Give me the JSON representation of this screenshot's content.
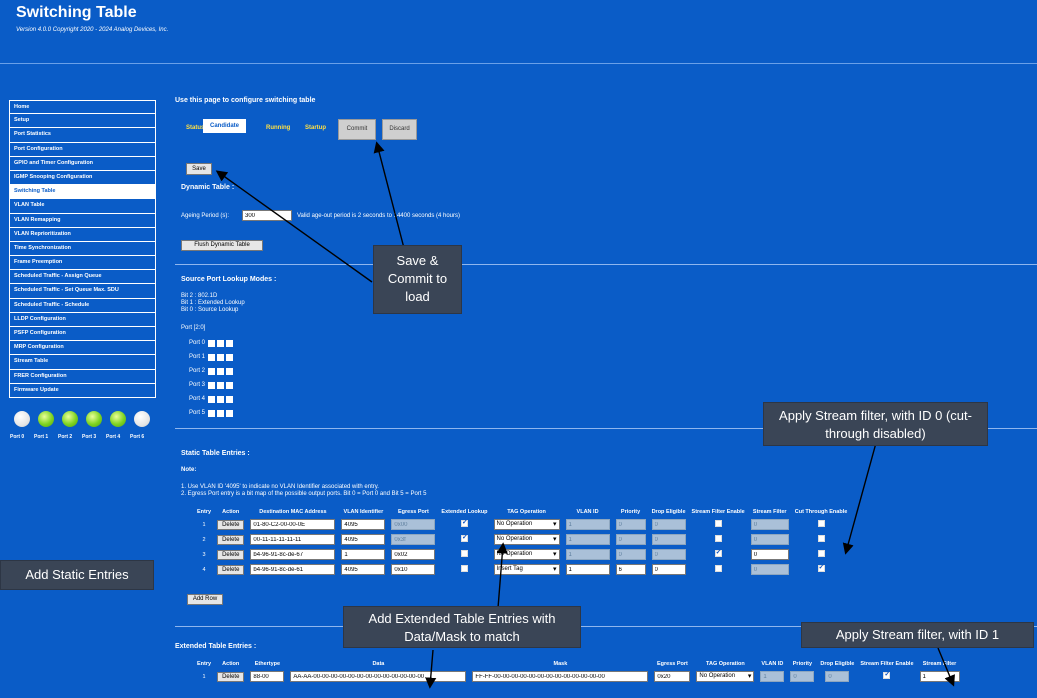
{
  "header": {
    "title": "Switching Table",
    "version": "Version 4.0.0 Copyright 2020 - 2024 Analog Devices, Inc."
  },
  "sidebar": {
    "items": [
      {
        "label": "Home"
      },
      {
        "label": "Setup"
      },
      {
        "label": "Port Statistics"
      },
      {
        "label": "Port Configuration"
      },
      {
        "label": "GPIO and Timer Configuration"
      },
      {
        "label": "IGMP Snooping Configuration"
      },
      {
        "label": "Switching Table"
      },
      {
        "label": "VLAN Table"
      },
      {
        "label": "VLAN Remapping"
      },
      {
        "label": "VLAN Reprioritization"
      },
      {
        "label": "Time Synchronization"
      },
      {
        "label": "Frame Preemption"
      },
      {
        "label": "Scheduled Traffic - Assign Queue"
      },
      {
        "label": "Scheduled Traffic - Set Queue Max. SDU"
      },
      {
        "label": "Scheduled Traffic - Schedule"
      },
      {
        "label": "LLDP Configuration"
      },
      {
        "label": "PSFP Configuration"
      },
      {
        "label": "MRP Configuration"
      },
      {
        "label": "Stream Table"
      },
      {
        "label": "FRER Configuration"
      },
      {
        "label": "Firmware Update"
      }
    ],
    "ports": [
      "Port 0",
      "Port 1",
      "Port 2",
      "Port 3",
      "Port 4",
      "Port 6"
    ]
  },
  "main": {
    "intro": "Use this page to configure switching table",
    "tabs": {
      "status": "Status",
      "candidate": "Candidate",
      "running": "Running",
      "startup": "Startup"
    },
    "commit": "Commit",
    "discard": "Discard",
    "save": "Save",
    "dynamic_title": "Dynamic Table :",
    "ageing_label": "Ageing Period (s):",
    "ageing_value": "300",
    "ageing_hint": "Valid age-out period is 2 seconds to 14400 seconds (4 hours)",
    "flush": "Flush Dynamic Table",
    "source_title": "Source Port Lookup Modes :",
    "bit2": "Bit 2 : 802.1D",
    "bit1": "Bit 1 : Extended Lookup",
    "bit0": "Bit 0 : Source Lookup",
    "port_range": "Port [2:0]",
    "lookup_ports": [
      "Port 0",
      "Port 1",
      "Port 2",
      "Port 3",
      "Port 4",
      "Port 5"
    ],
    "static_title": "Static Table Entries :",
    "note": "Note:",
    "note1": "1. Use VLAN ID '4095' to indicate no VLAN Identifier associated with entry.",
    "note2": "2. Egress Port entry is a bit map of the possible output ports. Bit 0 = Port 0 and Bit 5 = Port 5",
    "static_headers": [
      "Entry",
      "Action",
      "Destination MAC Address",
      "VLAN Identifier",
      "Egress Port",
      "Extended Lookup",
      "TAG Operation",
      "VLAN ID",
      "Priority",
      "Drop Eligible",
      "Stream Filter Enable",
      "Stream Filter",
      "Cut Through Enable"
    ],
    "static_rows": [
      {
        "entry": "1",
        "action": "Delete",
        "mac": "01-80-C2-00-00-0E",
        "vlan": "4095",
        "egress": "0x00",
        "ext": true,
        "tag": "No Operation",
        "vid": "1",
        "prio": "0",
        "drop": "0",
        "sfe": false,
        "sf": "0",
        "cte": false
      },
      {
        "entry": "2",
        "action": "Delete",
        "mac": "00-11-11-11-11-11",
        "vlan": "4095",
        "egress": "0x3f",
        "ext": true,
        "tag": "No Operation",
        "vid": "1",
        "prio": "0",
        "drop": "0",
        "sfe": false,
        "sf": "0",
        "cte": false
      },
      {
        "entry": "3",
        "action": "Delete",
        "mac": "b4-96-91-8c-de-67",
        "vlan": "1",
        "egress": "0x02",
        "ext": false,
        "tag": "No Operation",
        "vid": "1",
        "prio": "0",
        "drop": "0",
        "sfe": true,
        "sf": "0",
        "cte": false
      },
      {
        "entry": "4",
        "action": "Delete",
        "mac": "b4-96-91-8c-de-61",
        "vlan": "4095",
        "egress": "0x10",
        "ext": false,
        "tag": "Insert Tag",
        "vid": "1",
        "prio": "6",
        "drop": "0",
        "sfe": false,
        "sf": "0",
        "cte": true
      }
    ],
    "add_row": "Add Row",
    "ext_title": "Extended Table Entries :",
    "ext_headers": [
      "Entry",
      "Action",
      "Ethertype",
      "Data",
      "Mask",
      "Egress Port",
      "TAG Operation",
      "VLAN ID",
      "Priority",
      "Drop Eligible",
      "Stream Filter Enable",
      "Stream Filter"
    ],
    "ext_row": {
      "entry": "1",
      "action": "Delete",
      "ethertype": "88-00",
      "data": "AA-AA-00-00-00-00-00-00-00-00-00-00-00-00-00",
      "mask": "FF-FF-00-00-00-00-00-00-00-00-00-00-00-00-00",
      "egress": "0x20",
      "tag": "No Operation",
      "vid": "1",
      "prio": "0",
      "drop": "0",
      "sfe": true,
      "sf": "1"
    }
  },
  "callouts": {
    "save_commit": "Save & Commit to load",
    "stream0": "Apply Stream filter, with ID 0 (cut-through disabled)",
    "add_static": "Add Static Entries",
    "ext_entries": "Add Extended Table Entries with Data/Mask to match",
    "stream1": "Apply Stream filter, with ID 1"
  }
}
